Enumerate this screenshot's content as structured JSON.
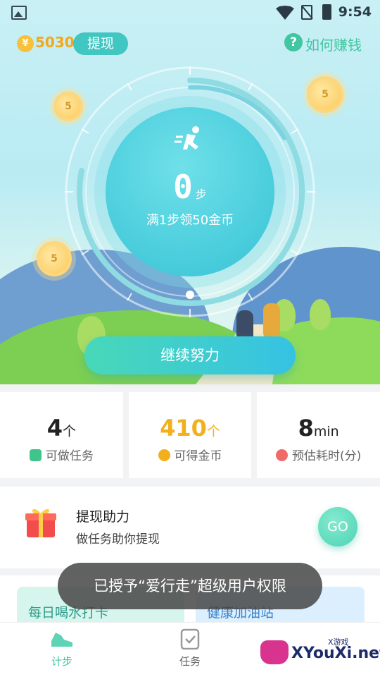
{
  "status_bar": {
    "time": "9:54"
  },
  "header": {
    "coin_symbol": "¥",
    "coin_balance": "5030",
    "withdraw_label": "提现",
    "help_icon_glyph": "?",
    "help_label": "如何赚钱"
  },
  "coins": {
    "value": "5"
  },
  "dial": {
    "steps": "0",
    "steps_unit": "步",
    "hint": "满1步领50金币"
  },
  "cta_label": "继续努力",
  "stats": [
    {
      "value": "4",
      "unit": "个",
      "label": "可做任务",
      "icon": "clipboard-check-icon",
      "color": "#3fc58c"
    },
    {
      "value": "410",
      "unit": "个",
      "label": "可得金币",
      "icon": "coin-icon",
      "color": "#f2b01d"
    },
    {
      "value": "8",
      "unit": "min",
      "label": "预估耗时(分)",
      "icon": "clock-icon",
      "color": "#f06a6a"
    }
  ],
  "help_card": {
    "title": "提现助力",
    "subtitle": "做任务助你提现",
    "go_label": "GO"
  },
  "banners": [
    {
      "label": "每日喝水打卡"
    },
    {
      "label": "健康加油站"
    }
  ],
  "toast": "已授予“爱行走”超级用户权限",
  "tabbar": {
    "items": [
      {
        "label": "计步",
        "icon": "shoe-icon",
        "active": true
      },
      {
        "label": "任务",
        "icon": "task-clipboard-icon",
        "active": false
      }
    ]
  },
  "watermark": {
    "brand": "XYouXi.net",
    "small": "X游戏"
  },
  "colors": {
    "accent": "#41c6c1",
    "coin": "#f2a81d",
    "cta_start": "#48d8b8",
    "cta_end": "#36c2e4"
  }
}
